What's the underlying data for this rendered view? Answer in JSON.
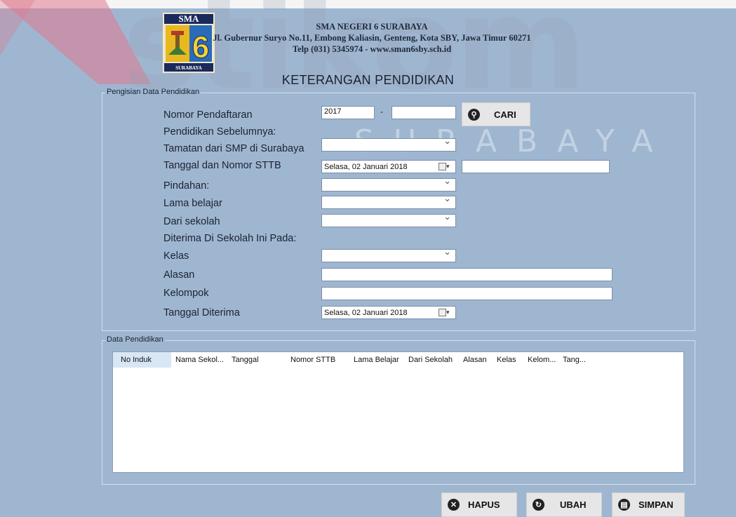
{
  "watermark": {
    "brand": "stikom",
    "city": "SURABAYA"
  },
  "header": {
    "logo_top": "SMA",
    "logo_number": "6",
    "logo_bottom": "SURABAYA",
    "school_name": "SMA NEGERI 6 SURABAYA",
    "address": "Jl. Gubernur Suryo No.11, Embong Kaliasin, Genteng, Kota SBY, Jawa Timur 60271",
    "contact": "Telp (031) 5345974 - www.sman6sby.sch.id",
    "title": "KETERANGAN PENDIDIKAN"
  },
  "form": {
    "legend": "Pengisian Data Pendidikan",
    "labels": {
      "nomor": "Nomor Pendaftaran",
      "sebelumnya": "Pendidikan Sebelumnya:",
      "tamatan": "Tamatan dari SMP di Surabaya",
      "tanggal_sttb": "Tanggal dan Nomor STTB",
      "pindahan": "Pindahan:",
      "lama": "Lama belajar",
      "dari": "Dari sekolah",
      "diterima": "Diterima Di Sekolah Ini Pada:",
      "kelas": "Kelas",
      "alasan": "Alasan",
      "kelompok": "Kelompok",
      "tanggal_diterima": "Tanggal Diterima"
    },
    "nomor_prefix": "2017",
    "nomor_separator": "-",
    "nomor_value": "",
    "cari_label": "CARI",
    "date_sttb": "Selasa, 02  Januari  2018",
    "date_diterima": "Selasa, 02  Januari  2018",
    "nomor_sttb": "",
    "alasan": "",
    "kelompok": ""
  },
  "table": {
    "legend": "Data Pendidikan",
    "columns": [
      "No Induk",
      "Nama Sekol...",
      "Tanggal",
      "Nomor STTB",
      "Lama Belajar",
      "Dari Sekolah",
      "Alasan",
      "Kelas",
      "Kelom...",
      "Tang..."
    ],
    "rows": []
  },
  "buttons": {
    "hapus": "HAPUS",
    "ubah": "UBAH",
    "simpan": "SIMPAN"
  },
  "colors": {
    "window_bg": "#9fb6d1",
    "header_bg": "#f5f5f5",
    "watermark": "#e07a8a"
  }
}
